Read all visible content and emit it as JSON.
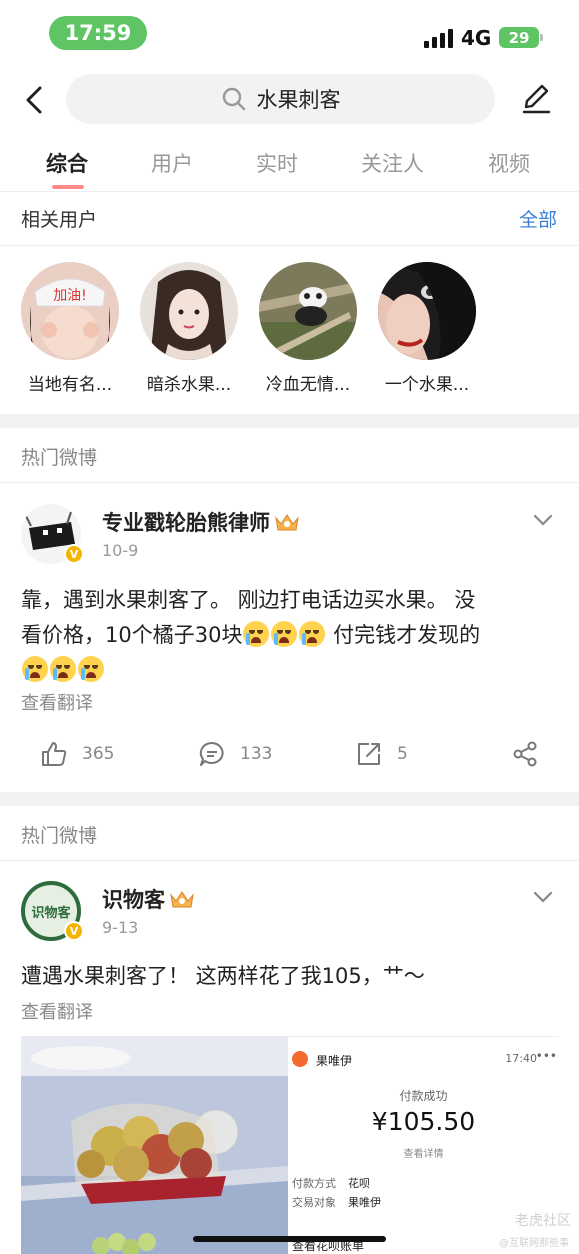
{
  "status_bar": {
    "time": "17:59",
    "network": "4G",
    "battery": "29"
  },
  "search": {
    "query": "水果刺客"
  },
  "tabs": [
    {
      "label": "综合",
      "active": true
    },
    {
      "label": "用户"
    },
    {
      "label": "实时"
    },
    {
      "label": "关注人"
    },
    {
      "label": "视频"
    }
  ],
  "related_users": {
    "title": "相关用户",
    "more": "全部",
    "users": [
      {
        "name": "当地有名..."
      },
      {
        "name": "暗杀水果..."
      },
      {
        "name": "冷血无情..."
      },
      {
        "name": "一个水果..."
      }
    ]
  },
  "posts": [
    {
      "section_label": "热门微博",
      "author": "专业戳轮胎熊律师",
      "date": "10-9",
      "text_line1": "靠，遇到水果刺客了。 刚边打电话边买水果。 没",
      "text_line2a": "看价格，10个橘子30块",
      "text_line2b": " 付完钱才发现的",
      "emoji_count_line2": 3,
      "emoji_count_line3": 3,
      "translate": "查看翻译",
      "likes": "365",
      "comments": "133",
      "reposts": "5"
    },
    {
      "section_label": "热门微博",
      "author": "识物客",
      "avatar_text": "识物客",
      "date": "9-13",
      "text": "遭遇水果刺客了！ 这两样花了我105，艹～",
      "translate": "查看翻译",
      "receipt": {
        "merchant": "果唯伊",
        "time": "17:40",
        "status": "付款成功",
        "amount": "¥105.50",
        "detail": "查看详情",
        "pay_method_label": "付款方式",
        "pay_method": "花呗",
        "target_label": "交易对象",
        "target": "果唯伊",
        "footer": "查看花呗账单"
      }
    }
  ],
  "watermark": {
    "line1": "老虎社区",
    "line2": "@互联网那些事"
  },
  "colors": {
    "accent_blue": "#3b7fd4",
    "tab_indicator": "#ff8a8a",
    "status_green": "#5ec464"
  }
}
